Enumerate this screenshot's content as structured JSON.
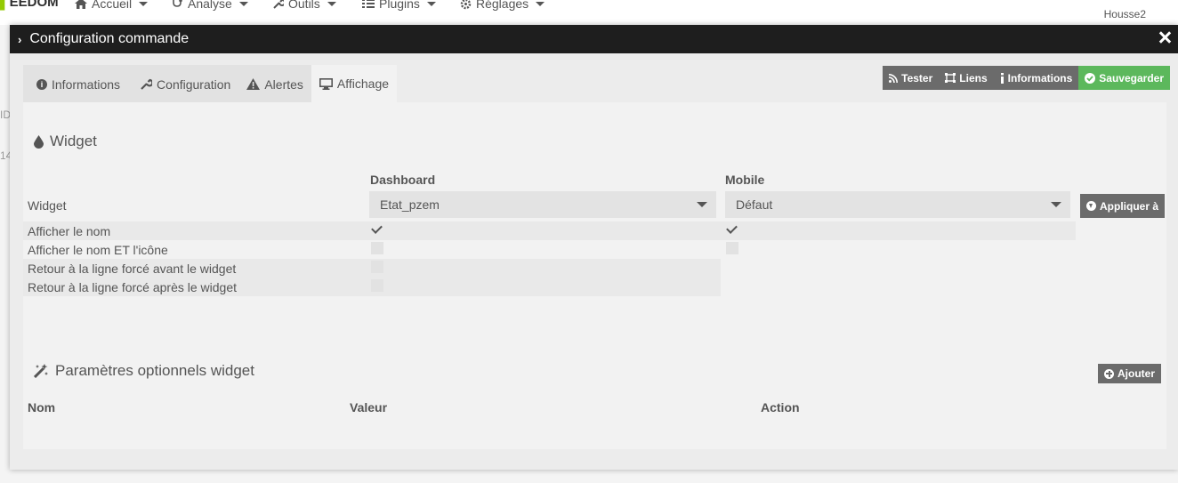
{
  "navbar": {
    "logo_text": "EEDOM",
    "items": [
      {
        "label": "Accueil",
        "icon": "home-icon"
      },
      {
        "label": "Analyse",
        "icon": "stethoscope-icon"
      },
      {
        "label": "Outils",
        "icon": "wrench-icon"
      },
      {
        "label": "Plugins",
        "icon": "tasks-icon"
      },
      {
        "label": "Réglages",
        "icon": "cogs-icon"
      }
    ],
    "user": "Housse2"
  },
  "background": {
    "frag1": "ID",
    "frag2": "14"
  },
  "modal": {
    "title": "Configuration commande",
    "tabs": [
      {
        "label": "Informations",
        "icon": "info-circle-icon"
      },
      {
        "label": "Configuration",
        "icon": "wrench-icon"
      },
      {
        "label": "Alertes",
        "icon": "warning-icon"
      },
      {
        "label": "Affichage",
        "icon": "desktop-icon",
        "active": true
      }
    ],
    "actions": [
      {
        "label": "Tester",
        "icon": "rss-icon"
      },
      {
        "label": "Liens",
        "icon": "sitemap-icon"
      },
      {
        "label": "Informations",
        "icon": "info-icon"
      },
      {
        "label": "Sauvegarder",
        "icon": "check-circle-icon",
        "color": "#5cb85c"
      }
    ]
  },
  "widget_section": {
    "title": "Widget",
    "col_dashboard": "Dashboard",
    "col_mobile": "Mobile",
    "row_widget_label": "Widget",
    "dashboard_widget_value": "Etat_pzem",
    "mobile_widget_value": "Défaut",
    "apply_button": "Appliquer à",
    "rows": [
      {
        "label": "Afficher le nom",
        "dashboard": true,
        "mobile": true
      },
      {
        "label": "Afficher le nom ET l'icône",
        "dashboard": false,
        "mobile": false
      },
      {
        "label": "Retour à la ligne forcé avant le widget",
        "dashboard": false
      },
      {
        "label": "Retour à la ligne forcé après le widget",
        "dashboard": false
      }
    ]
  },
  "optional_section": {
    "title": "Paramètres optionnels widget",
    "add_button": "Ajouter",
    "columns": [
      "Nom",
      "Valeur",
      "Action"
    ]
  },
  "colors": {
    "accent_green": "#94ca02",
    "save_green": "#5cb85c",
    "header_dark": "#1e1e1e",
    "button_gray": "#6b6b6b"
  }
}
